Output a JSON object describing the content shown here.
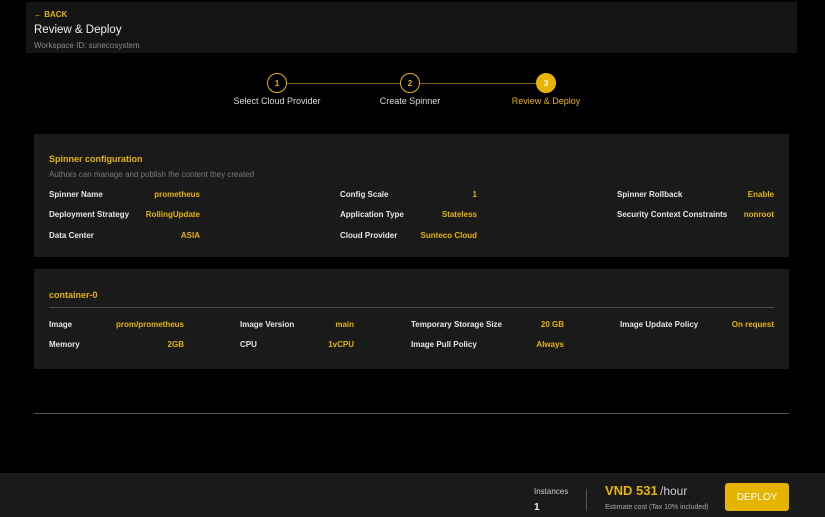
{
  "header": {
    "back": "← BACK",
    "title": "Review & Deploy",
    "workspace": "Workspace ID: sunecosystem"
  },
  "steps": [
    {
      "num": "1",
      "label": "Select Cloud Provider"
    },
    {
      "num": "2",
      "label": "Create Spinner"
    },
    {
      "num": "3",
      "label": "Review & Deploy"
    }
  ],
  "spinner": {
    "title": "Spinner configuration",
    "subtitle": "Authors can manage and publish the content they created",
    "fields": [
      {
        "label": "Spinner Name",
        "value": "prometheus"
      },
      {
        "label": "Config Scale",
        "value": "1"
      },
      {
        "label": "Spinner Rollback",
        "value": "Enable"
      },
      {
        "label": "Deployment Strategy",
        "value": "RollingUpdate"
      },
      {
        "label": "Application Type",
        "value": "Stateless"
      },
      {
        "label": "Security Context Constraints",
        "value": "nonroot"
      },
      {
        "label": "Data Center",
        "value": "ASIA"
      },
      {
        "label": "Cloud Provider",
        "value": "Sunteco Cloud"
      }
    ]
  },
  "container": {
    "title": "container-0",
    "fields": [
      {
        "label": "Image",
        "value": "prom/prometheus"
      },
      {
        "label": "Image Version",
        "value": "main"
      },
      {
        "label": "Temporary Storage Size",
        "value": "20 GB"
      },
      {
        "label": "Image Update Policy",
        "value": "On request"
      },
      {
        "label": "Memory",
        "value": "2GB"
      },
      {
        "label": "CPU",
        "value": "1vCPU"
      },
      {
        "label": "Image Pull Policy",
        "value": "Always"
      }
    ]
  },
  "footer": {
    "instances_label": "Instances",
    "instances": "1",
    "price": "VND 531",
    "unit": "/hour",
    "note": "Estimate cost (Tax 10% included)",
    "deploy": "DEPLOY"
  }
}
